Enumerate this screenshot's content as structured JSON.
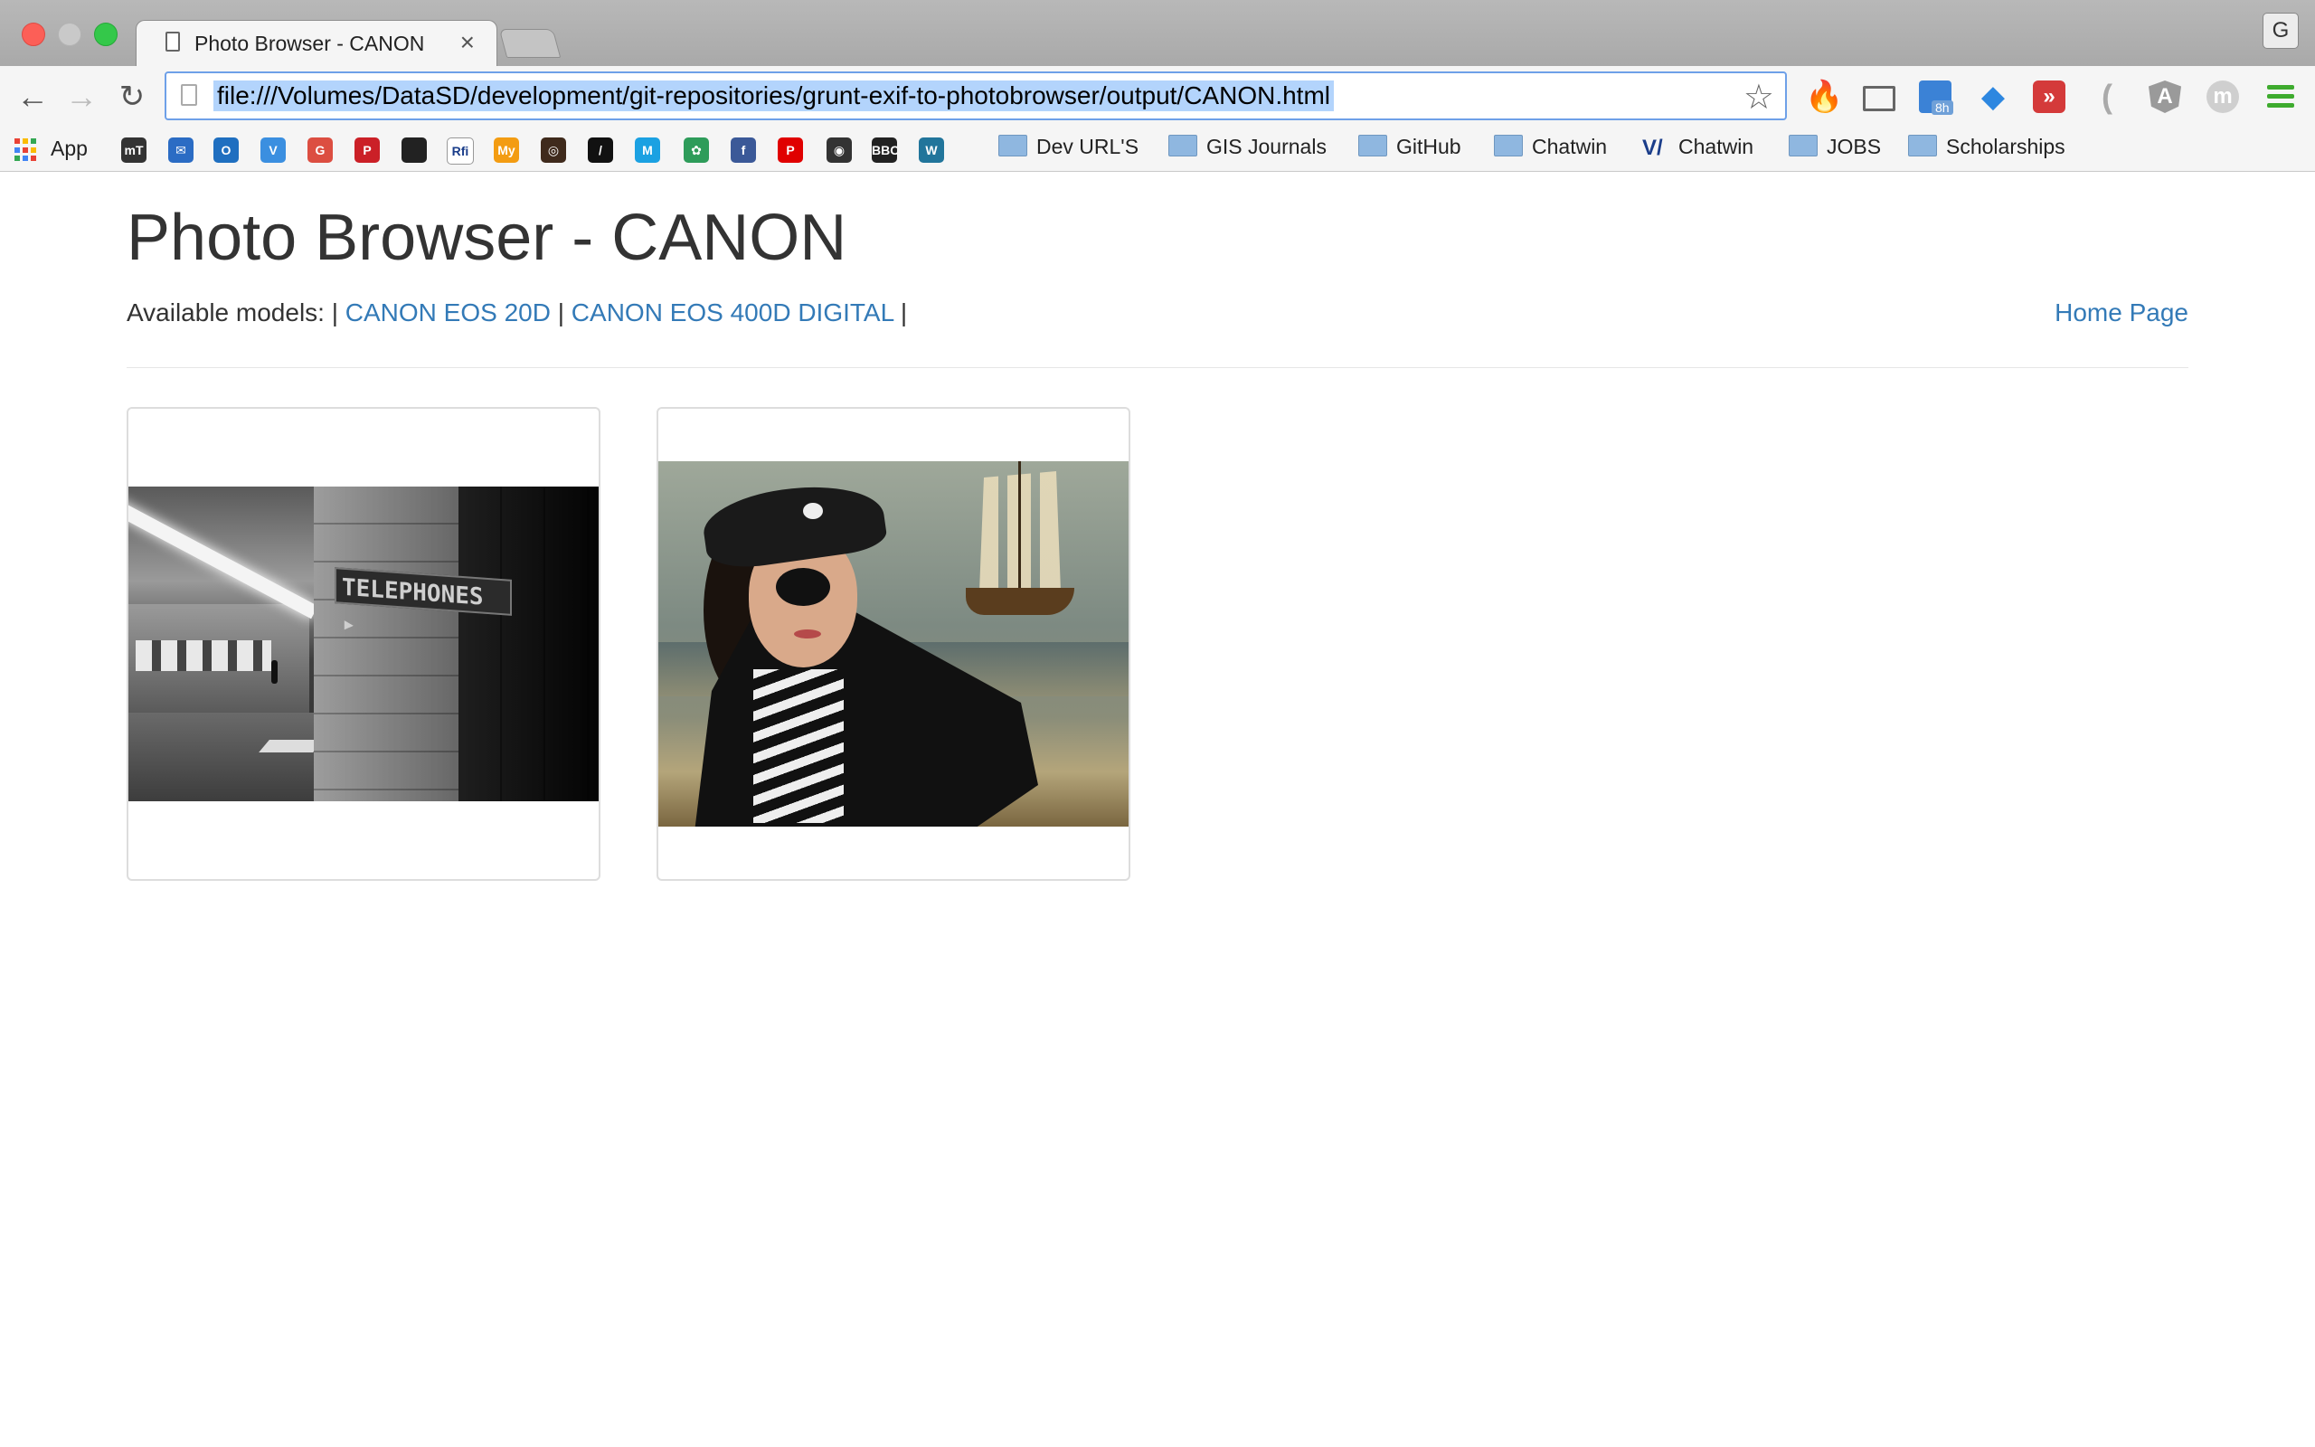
{
  "browser": {
    "tab_title": "Photo Browser - CANON",
    "tab_close_glyph": "×",
    "profile_initial": "G",
    "url": "file:///Volumes/DataSD/development/git-repositories/grunt-exif-to-photobrowser/output/CANON.html",
    "extensions": [
      "fire-icon",
      "cast-icon",
      "calendar-icon",
      "diamond-icon",
      "forward-icon",
      "quote-icon",
      "angular-icon",
      "m-icon"
    ],
    "calendar_badge": "8h"
  },
  "bookmarks": {
    "apps_label": "App",
    "icon_bookmarks": [
      {
        "name": "mt-icon",
        "glyph": "mT",
        "color": "#333333"
      },
      {
        "name": "mail-icon",
        "glyph": "✉",
        "color": "#2b6cc4"
      },
      {
        "name": "outlook-icon",
        "glyph": "O",
        "color": "#1f6fc0"
      },
      {
        "name": "v-icon",
        "glyph": "V",
        "color": "#3b8fe0"
      },
      {
        "name": "google-plus-icon",
        "glyph": "G",
        "color": "#dc4e41"
      },
      {
        "name": "pinterest-icon",
        "glyph": "P",
        "color": "#cb2027"
      },
      {
        "name": "delicious-icon",
        "glyph": "",
        "color": "#222222"
      },
      {
        "name": "rfi-icon",
        "glyph": "Rfi",
        "color": "#ffffff"
      },
      {
        "name": "my-icon",
        "glyph": "My",
        "color": "#f39c12"
      },
      {
        "name": "instagram-icon",
        "glyph": "◎",
        "color": "#3f2a1c"
      },
      {
        "name": "stripe-icon",
        "glyph": "/",
        "color": "#111111"
      },
      {
        "name": "m-square-icon",
        "glyph": "M",
        "color": "#1ba1e2"
      },
      {
        "name": "tree-icon",
        "glyph": "✿",
        "color": "#2e9c5a"
      },
      {
        "name": "facebook-icon",
        "glyph": "f",
        "color": "#3b5998"
      },
      {
        "name": "p-icon",
        "glyph": "P",
        "color": "#e00000"
      },
      {
        "name": "camera-icon",
        "glyph": "◉",
        "color": "#333333"
      },
      {
        "name": "bbc-icon",
        "glyph": "BBC",
        "color": "#222222"
      },
      {
        "name": "wordpress-icon",
        "glyph": "W",
        "color": "#21759b"
      }
    ],
    "folders": [
      {
        "label": "Dev URL'S",
        "type": "folder"
      },
      {
        "label": "GIS Journals",
        "type": "folder"
      },
      {
        "label": "GitHub",
        "type": "folder"
      },
      {
        "label": "Chatwin",
        "type": "folder"
      },
      {
        "label": "Chatwin",
        "type": "link"
      },
      {
        "label": "JOBS",
        "type": "folder"
      },
      {
        "label": "Scholarships",
        "type": "folder"
      }
    ]
  },
  "page": {
    "title": "Photo Browser - CANON",
    "models_prefix": "Available models: |",
    "models": [
      "CANON EOS 20D",
      "CANON EOS 400D DIGITAL"
    ],
    "separator": "|",
    "trailing": "|",
    "home_link": "Home Page",
    "photos": [
      {
        "name": "photo-telephones",
        "sign_text": "TELEPHONES ▸"
      },
      {
        "name": "photo-pirate"
      }
    ],
    "link_color": "#337ab7"
  }
}
